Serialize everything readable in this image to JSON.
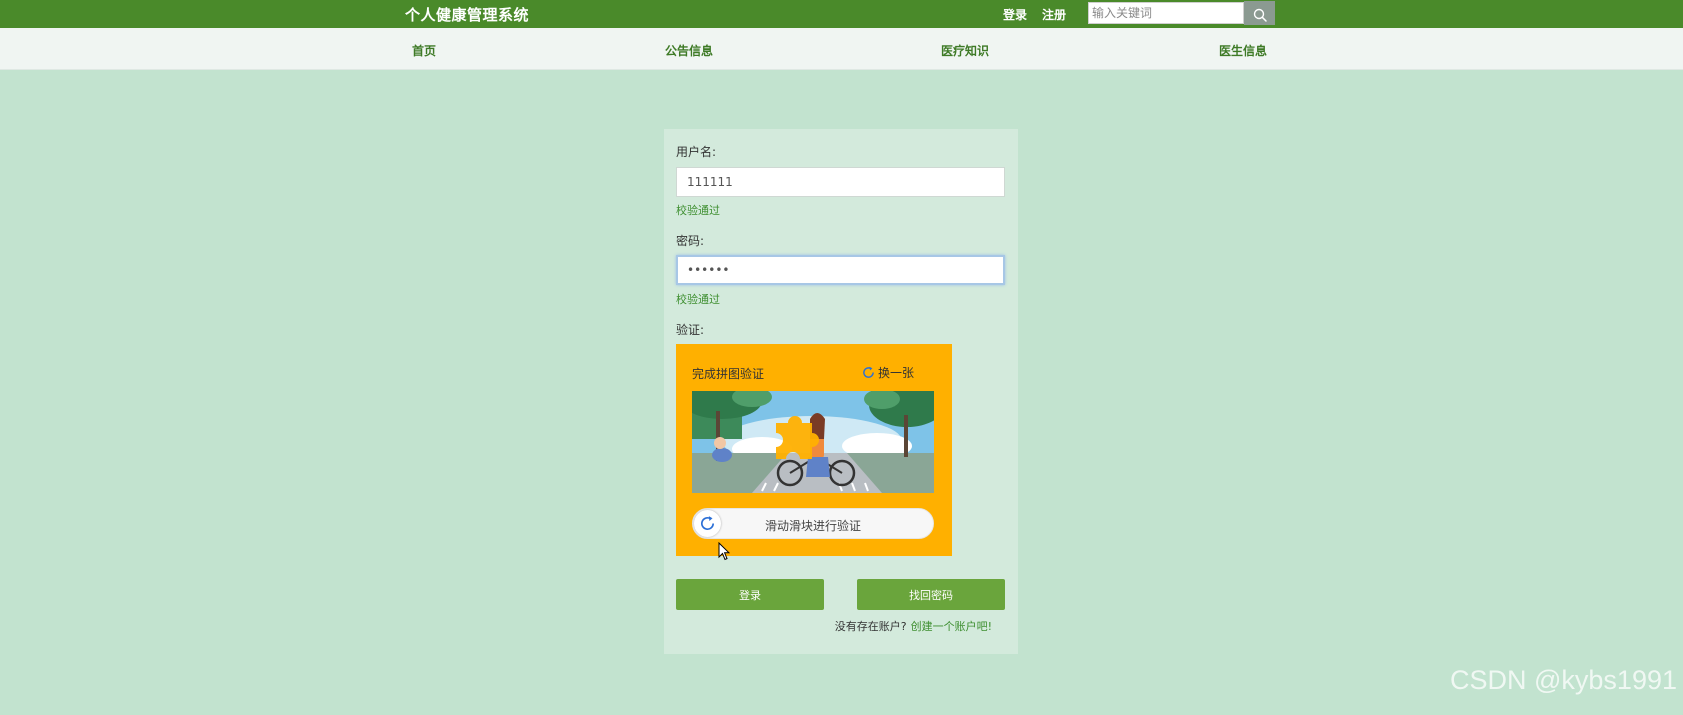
{
  "header": {
    "site_title": "个人健康管理系统",
    "login_link": "登录",
    "register_link": "注册",
    "search_placeholder": "输入关键词",
    "search_icon": "search-icon"
  },
  "nav": {
    "items": [
      {
        "label": "首页"
      },
      {
        "label": "公告信息"
      },
      {
        "label": "医疗知识"
      },
      {
        "label": "医生信息"
      }
    ]
  },
  "login_form": {
    "username_label": "用户名:",
    "username_value": "111111",
    "username_hint": "校验通过",
    "password_label": "密码:",
    "password_value": "••••••",
    "password_hint": "校验通过",
    "verify_label": "验证:",
    "captcha": {
      "title": "完成拼图验证",
      "refresh_label": "换一张",
      "slider_text": "滑动滑块进行验证",
      "background_color": "#ffb000"
    },
    "login_button": "登录",
    "recover_button": "找回密码",
    "no_account_text": "没有存在账户?",
    "create_account_link": "创建一个账户吧!"
  },
  "watermark": "CSDN @kybs1991",
  "colors": {
    "header_bg": "#4a8a2a",
    "page_bg": "#c2e3cf",
    "card_bg": "#d3eadc",
    "button_bg": "#6aa53c",
    "hint_color": "#3e8f30"
  }
}
